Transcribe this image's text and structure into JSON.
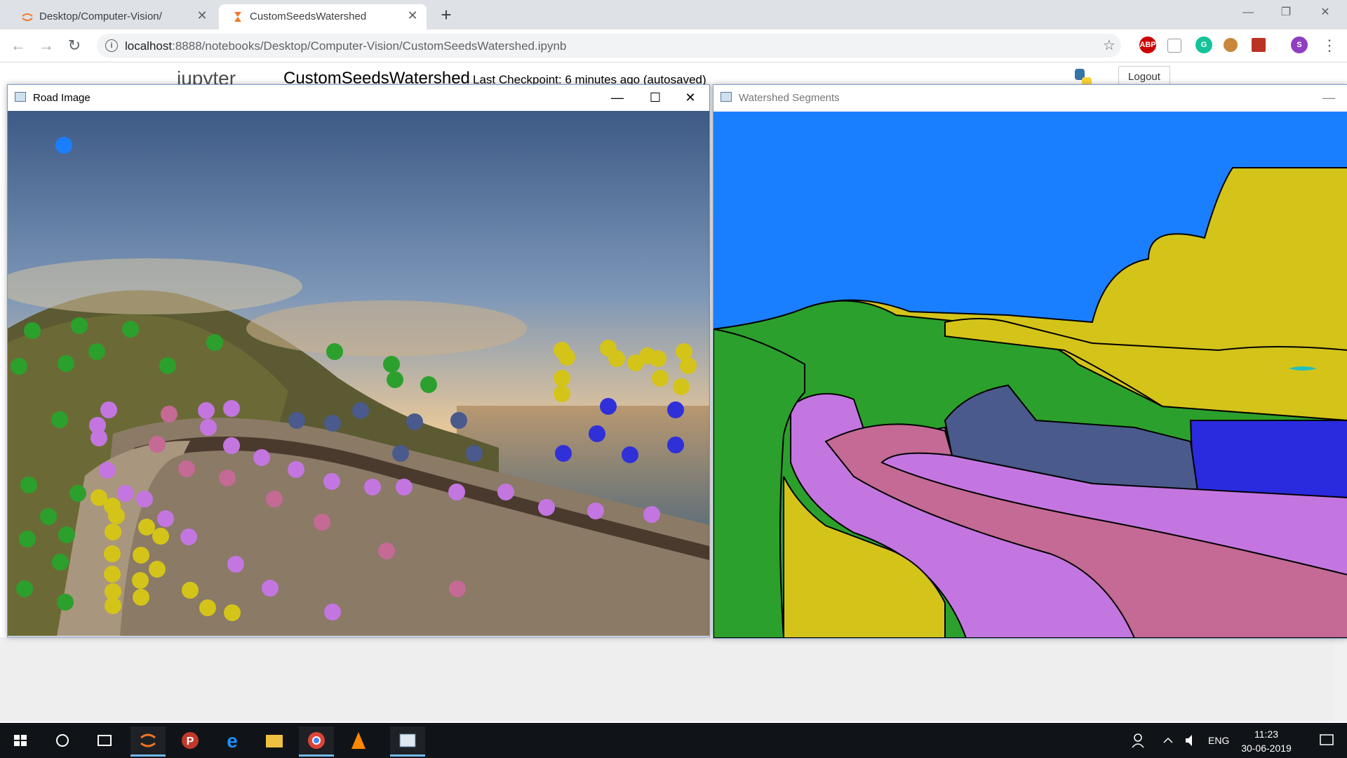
{
  "browser": {
    "tabs": [
      {
        "title": "Desktop/Computer-Vision/",
        "active": false
      },
      {
        "title": "CustomSeedsWatershed",
        "active": true
      }
    ],
    "url_host": "localhost",
    "url_path": ":8888/notebooks/Desktop/Computer-Vision/CustomSeedsWatershed.ipynb",
    "profile_initial": "S",
    "extensions": [
      "ABP",
      "G"
    ]
  },
  "jupyter": {
    "logo": "jupyter",
    "notebook_name": "CustomSeedsWatershed",
    "checkpoint": "Last Checkpoint: 6 minutes ago  (autosaved)",
    "logout_label": "Logout"
  },
  "windows": {
    "road": {
      "title": "Road Image"
    },
    "watershed": {
      "title": "Watershed Segments"
    }
  },
  "taskbar": {
    "language": "ENG",
    "time": "11:23",
    "date": "30-06-2019"
  },
  "seed_colors": {
    "green": "#2ca02c",
    "yellow": "#d4c41a",
    "blue": "#3030d8",
    "slate": "#4a5a8c",
    "violet": "#c476e0",
    "pink": "#c46a94",
    "sky": "#1a7fff"
  }
}
